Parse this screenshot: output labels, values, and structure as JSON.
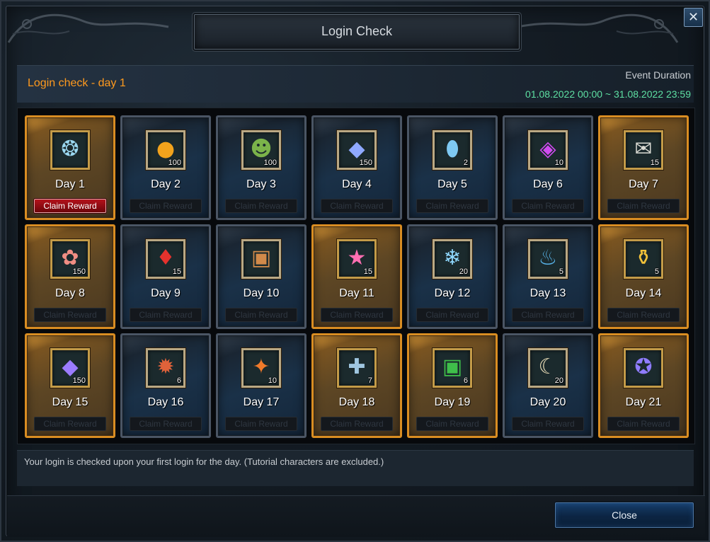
{
  "window": {
    "title": "Login Check",
    "close_icon": "close-icon"
  },
  "header": {
    "current_day": "Login check - day 1",
    "event_label": "Event Duration",
    "event_range": "01.08.2022 00:00 ~ 31.08.2022 23:59"
  },
  "rewards": [
    {
      "day": "Day 1",
      "qty": "",
      "frame": "gold",
      "icon": "amulet-icon",
      "glyph": "❂",
      "glyph_color": "#9ad7f0",
      "claim": "Claim Reward",
      "claim_state": "active"
    },
    {
      "day": "Day 2",
      "qty": "100",
      "frame": "blue",
      "icon": "amber-orb-icon",
      "glyph": "●",
      "glyph_color": "#f2a31c",
      "claim": "Claim Reward",
      "claim_state": "disabled"
    },
    {
      "day": "Day 3",
      "qty": "100",
      "frame": "blue",
      "icon": "frog-icon",
      "glyph": "☻",
      "glyph_color": "#7bb34a",
      "claim": "Claim Reward",
      "claim_state": "disabled"
    },
    {
      "day": "Day 4",
      "qty": "150",
      "frame": "blue",
      "icon": "blue-crystal-icon",
      "glyph": "◆",
      "glyph_color": "#8fa9ff",
      "claim": "Claim Reward",
      "claim_state": "disabled"
    },
    {
      "day": "Day 5",
      "qty": "2",
      "frame": "blue",
      "icon": "capsule-icon",
      "glyph": "⬮",
      "glyph_color": "#7ec9f2",
      "claim": "Claim Reward",
      "claim_state": "disabled"
    },
    {
      "day": "Day 6",
      "qty": "10",
      "frame": "blue",
      "icon": "prism-cube-icon",
      "glyph": "◈",
      "glyph_color": "#d04bf0",
      "claim": "Claim Reward",
      "claim_state": "disabled"
    },
    {
      "day": "Day 7",
      "qty": "15",
      "frame": "gold",
      "icon": "scroll-icon",
      "glyph": "✉",
      "glyph_color": "#d9dad2",
      "claim": "Claim Reward",
      "claim_state": "disabled"
    },
    {
      "day": "Day 8",
      "qty": "150",
      "frame": "gold",
      "icon": "coral-icon",
      "glyph": "✿",
      "glyph_color": "#f08d83",
      "claim": "Claim Reward",
      "claim_state": "disabled"
    },
    {
      "day": "Day 9",
      "qty": "15",
      "frame": "blue",
      "icon": "red-shard-icon",
      "glyph": "♦",
      "glyph_color": "#e6322d",
      "claim": "Claim Reward",
      "claim_state": "disabled"
    },
    {
      "day": "Day 10",
      "qty": "",
      "frame": "blue",
      "icon": "gift-box-icon",
      "glyph": "▣",
      "glyph_color": "#d28a4a",
      "claim": "Claim Reward",
      "claim_state": "disabled"
    },
    {
      "day": "Day 11",
      "qty": "15",
      "frame": "gold",
      "icon": "star-icon",
      "glyph": "★",
      "glyph_color": "#ff6fb2",
      "claim": "Claim Reward",
      "claim_state": "disabled"
    },
    {
      "day": "Day 12",
      "qty": "20",
      "frame": "blue",
      "icon": "ice-crystals-icon",
      "glyph": "❄",
      "glyph_color": "#8fd8ff",
      "claim": "Claim Reward",
      "claim_state": "disabled"
    },
    {
      "day": "Day 13",
      "qty": "5",
      "frame": "blue",
      "icon": "pouch-icon",
      "glyph": "♨",
      "glyph_color": "#57b2e8",
      "claim": "Claim Reward",
      "claim_state": "disabled"
    },
    {
      "day": "Day 14",
      "qty": "5",
      "frame": "gold",
      "icon": "treasure-chest-icon",
      "glyph": "⚱",
      "glyph_color": "#f2c23a",
      "claim": "Claim Reward",
      "claim_state": "disabled"
    },
    {
      "day": "Day 15",
      "qty": "150",
      "frame": "gold",
      "icon": "gem-icon",
      "glyph": "◆",
      "glyph_color": "#9b7cff",
      "claim": "Claim Reward",
      "claim_state": "disabled"
    },
    {
      "day": "Day 16",
      "qty": "6",
      "frame": "blue",
      "icon": "rune-stone-icon",
      "glyph": "✹",
      "glyph_color": "#e0623a",
      "claim": "Claim Reward",
      "claim_state": "disabled"
    },
    {
      "day": "Day 17",
      "qty": "10",
      "frame": "blue",
      "icon": "fire-seal-icon",
      "glyph": "✦",
      "glyph_color": "#f07a2a",
      "claim": "Claim Reward",
      "claim_state": "disabled"
    },
    {
      "day": "Day 18",
      "qty": "7",
      "frame": "gold",
      "icon": "cross-relic-icon",
      "glyph": "✚",
      "glyph_color": "#9fc6e0",
      "claim": "Claim Reward",
      "claim_state": "disabled"
    },
    {
      "day": "Day 19",
      "qty": "6",
      "frame": "gold",
      "icon": "green-gift-icon",
      "glyph": "▣",
      "glyph_color": "#3fbf4a",
      "claim": "Claim Reward",
      "claim_state": "disabled"
    },
    {
      "day": "Day 20",
      "qty": "20",
      "frame": "blue",
      "icon": "parchment-icon",
      "glyph": "☾",
      "glyph_color": "#e8dcb6",
      "claim": "Claim Reward",
      "claim_state": "disabled"
    },
    {
      "day": "Day 21",
      "qty": "",
      "frame": "gold",
      "icon": "spellbook-icon",
      "glyph": "✪",
      "glyph_color": "#8f7cff",
      "claim": "Claim Reward",
      "claim_state": "disabled"
    }
  ],
  "footer": {
    "note": "Your login is checked upon your first login for the day. (Tutorial characters are excluded.)",
    "close_label": "Close"
  }
}
